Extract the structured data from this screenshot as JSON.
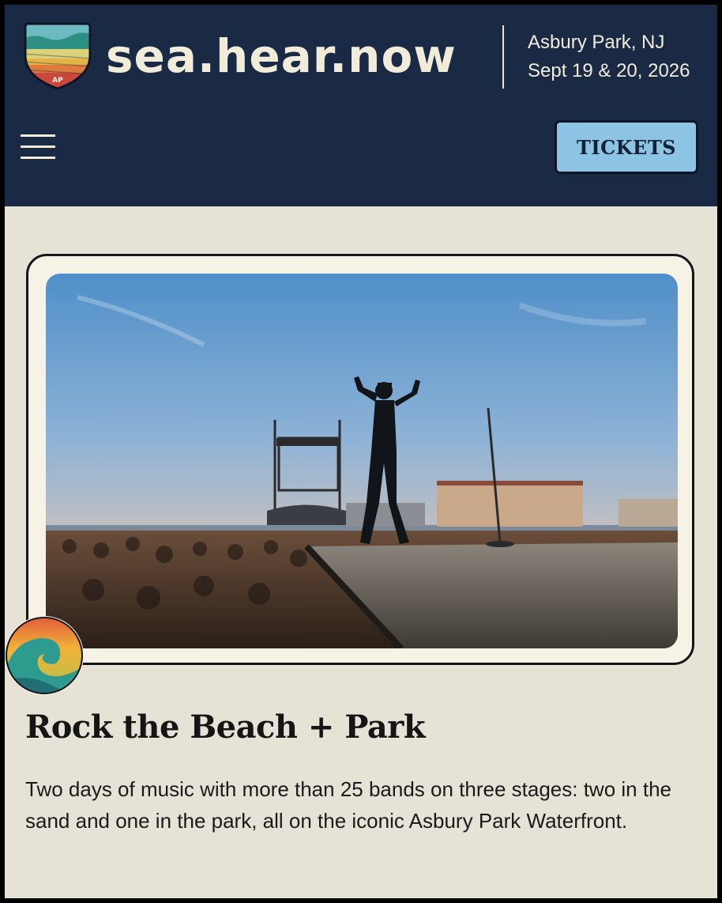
{
  "header": {
    "brand": "sea.hear.now",
    "badge_text": "AP",
    "location": "Asbury Park, NJ",
    "dates": "Sept 19 & 20, 2026",
    "menu_icon": "hamburger-menu-icon",
    "tickets_label": "TICKETS"
  },
  "hero": {
    "image": "performer-on-beach-stage-photo",
    "badge_icon": "wave-icon"
  },
  "content": {
    "title": "Rock the Beach + Park",
    "description": "Two days of music with more than 25 bands on three stages: two in the sand and one in the park, all on the iconic Asbury Park Waterfront."
  },
  "colors": {
    "header_bg": "#1b2a44",
    "page_bg": "#e6e3d6",
    "accent": "#8ec4e3",
    "text_light": "#f1ecda"
  }
}
